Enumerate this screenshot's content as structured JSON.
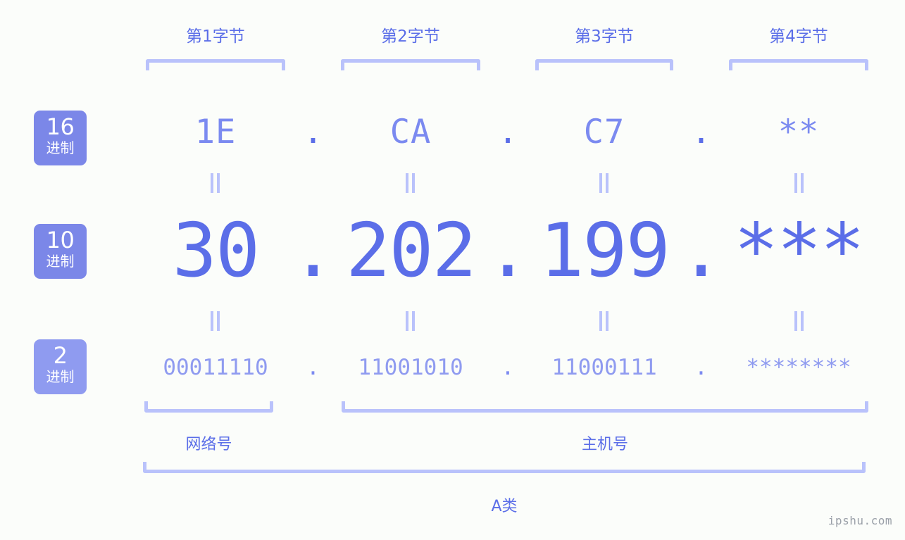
{
  "background_color": "#fbfdfa",
  "accent_color": "#5b6ee8",
  "accent_light": "#8f9bf0",
  "bracket_color": "#b9c2fb",
  "badge_color": "#7b87e8",
  "byte_headers": [
    {
      "label": "第1字节"
    },
    {
      "label": "第2字节"
    },
    {
      "label": "第3字节"
    },
    {
      "label": "第4字节"
    }
  ],
  "bases": [
    {
      "num": "16",
      "unit": "进制"
    },
    {
      "num": "10",
      "unit": "进制"
    },
    {
      "num": "2",
      "unit": "进制"
    }
  ],
  "separator": ".",
  "equals_symbol": "=",
  "rows": {
    "hex": {
      "base_label": "16",
      "values": [
        "1E",
        "CA",
        "C7",
        "**"
      ]
    },
    "decimal": {
      "base_label": "10",
      "values": [
        "30",
        "202",
        "199",
        "***"
      ]
    },
    "binary": {
      "base_label": "2",
      "values": [
        "00011110",
        "11001010",
        "11000111",
        "********"
      ]
    }
  },
  "sections": {
    "network": "网络号",
    "host": "主机号",
    "ip_class": "A类"
  },
  "watermark": "ipshu.com"
}
